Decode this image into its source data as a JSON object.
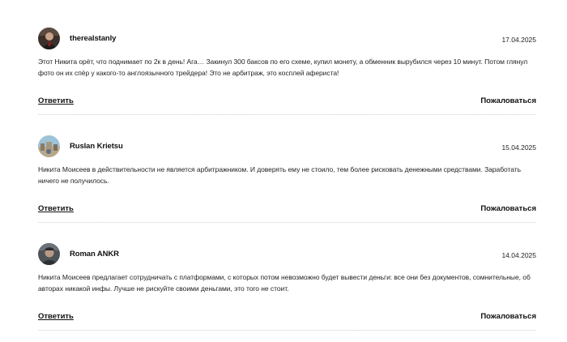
{
  "comments": [
    {
      "author": "therealstanly",
      "date": "17.04.2025",
      "text": "Этот Никита орёт, что поднимает по 2к в день! Ага… Закинул 300 баксов по его схеме, купил монету, а обменник вырубился через 10 минут. Потом глянул фото он их спёр у какого-то англоязычного трейдера! Это не арбитраж, это косплей афериста!",
      "reply_label": "Ответить",
      "report_label": "Пожаловаться"
    },
    {
      "author": "Ruslan Krietsu",
      "date": "15.04.2025",
      "text": "Никита Моисеев в действительности не является арбитражником. И доверять ему не стоило, тем более рисковать денежными средствами. Заработать ничего не получилось.",
      "reply_label": "Ответить",
      "report_label": "Пожаловаться"
    },
    {
      "author": "Roman ANKR",
      "date": "14.04.2025",
      "text": "Никита Моисеев предлагает сотрудничать с платформами, с которых потом невозможно будет вывести деньги: все они без документов, сомнительные, об авторах никакой инфы. Лучше не рискуйте своими деньгами, это того не стоит.",
      "reply_label": "Ответить",
      "report_label": "Пожаловаться"
    }
  ]
}
